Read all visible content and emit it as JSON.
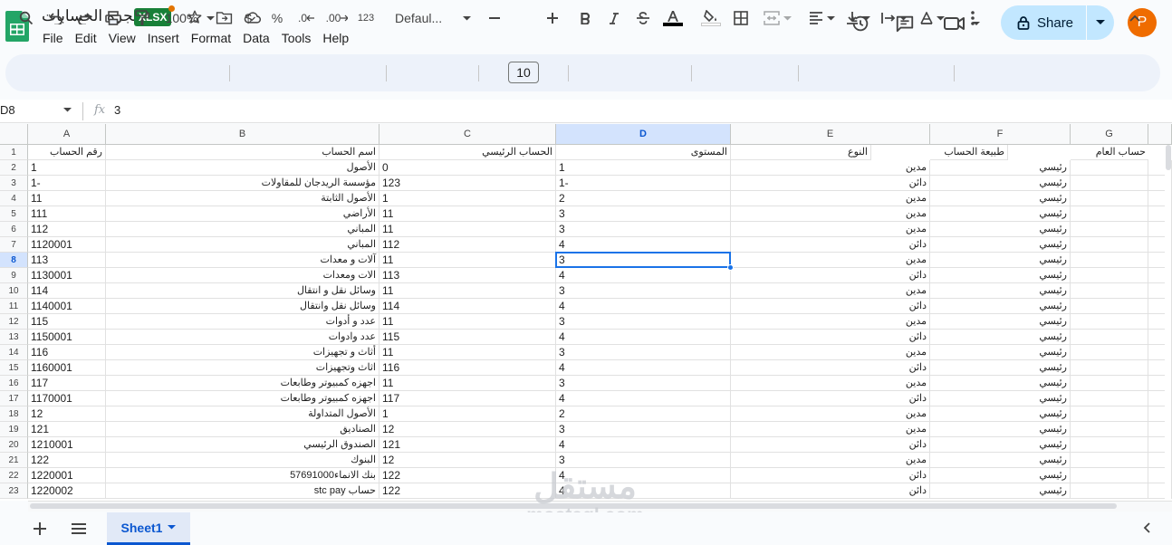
{
  "document": {
    "title": "شجره الحسابات",
    "file_badge": "XLSX"
  },
  "menu": [
    "File",
    "Edit",
    "View",
    "Insert",
    "Format",
    "Data",
    "Tools",
    "Help"
  ],
  "share": {
    "label": "Share"
  },
  "avatar": {
    "initial": "P",
    "color": "#ef6c00"
  },
  "toolbar": {
    "zoom": "100%",
    "currency": "$",
    "percent": "%",
    "dec_less": ".0",
    "dec_more": ".00",
    "number_format": "123",
    "font": "Defaul...",
    "font_size": "10"
  },
  "formula_bar": {
    "cell_ref": "D8",
    "fx": "fx",
    "value": "3"
  },
  "columns": [
    "A",
    "B",
    "C",
    "D",
    "E",
    "F",
    "G"
  ],
  "selected": {
    "row": 8,
    "col": "D",
    "accent": "#1a73e8"
  },
  "headers": {
    "A": "رقم الحساب",
    "B": "اسم الحساب",
    "C": "الحساب الرئيسي",
    "D": "المستوى",
    "E": "",
    "F": "النوع",
    "G": "طبيعة الحساب",
    "H": "حساب العام"
  },
  "rows": [
    {
      "n": "2",
      "a": "1",
      "b": "الأصول",
      "c": "0",
      "d": "1",
      "f": "مدين",
      "g": "رئيسي"
    },
    {
      "n": "3",
      "a": "1-",
      "b": "مؤسسة الريدجان للمقاولات",
      "c": "123",
      "d": "1-",
      "f": "دائن",
      "g": "رئيسي"
    },
    {
      "n": "4",
      "a": "11",
      "b": "الأصول الثابتة",
      "c": "1",
      "d": "2",
      "f": "مدين",
      "g": "رئيسي"
    },
    {
      "n": "5",
      "a": "111",
      "b": "الأراضي",
      "c": "11",
      "d": "3",
      "f": "مدين",
      "g": "رئيسي"
    },
    {
      "n": "6",
      "a": "112",
      "b": "المباني",
      "c": "11",
      "d": "3",
      "f": "مدين",
      "g": "رئيسي"
    },
    {
      "n": "7",
      "a": "1120001",
      "b": "المباني",
      "c": "112",
      "d": "4",
      "f": "دائن",
      "g": "رئيسي"
    },
    {
      "n": "8",
      "a": "113",
      "b": "آلات و معدات",
      "c": "11",
      "d": "3",
      "f": "مدين",
      "g": "رئيسي"
    },
    {
      "n": "9",
      "a": "1130001",
      "b": "الات ومعدات",
      "c": "113",
      "d": "4",
      "f": "دائن",
      "g": "رئيسي"
    },
    {
      "n": "10",
      "a": "114",
      "b": "وسائل نقل و انتقال",
      "c": "11",
      "d": "3",
      "f": "مدين",
      "g": "رئيسي"
    },
    {
      "n": "11",
      "a": "1140001",
      "b": "وسائل نقل وانتقال",
      "c": "114",
      "d": "4",
      "f": "دائن",
      "g": "رئيسي"
    },
    {
      "n": "12",
      "a": "115",
      "b": "عدد و أدوات",
      "c": "11",
      "d": "3",
      "f": "مدين",
      "g": "رئيسي"
    },
    {
      "n": "13",
      "a": "1150001",
      "b": "عدد وادوات",
      "c": "115",
      "d": "4",
      "f": "دائن",
      "g": "رئيسي"
    },
    {
      "n": "14",
      "a": "116",
      "b": "أثاث و تجهيزات",
      "c": "11",
      "d": "3",
      "f": "مدين",
      "g": "رئيسي"
    },
    {
      "n": "15",
      "a": "1160001",
      "b": "اثاث وتجهيزات",
      "c": "116",
      "d": "4",
      "f": "دائن",
      "g": "رئيسي"
    },
    {
      "n": "16",
      "a": "117",
      "b": "اجهزه كمبيوتر وطابعات",
      "c": "11",
      "d": "3",
      "f": "مدين",
      "g": "رئيسي"
    },
    {
      "n": "17",
      "a": "1170001",
      "b": "اجهزه كمبيوتر وطابعات",
      "c": "117",
      "d": "4",
      "f": "دائن",
      "g": "رئيسي"
    },
    {
      "n": "18",
      "a": "12",
      "b": "الأصول المتداولة",
      "c": "1",
      "d": "2",
      "f": "مدين",
      "g": "رئيسي"
    },
    {
      "n": "19",
      "a": "121",
      "b": "الصناديق",
      "c": "12",
      "d": "3",
      "f": "مدين",
      "g": "رئيسي"
    },
    {
      "n": "20",
      "a": "1210001",
      "b": "الصندوق الرئيسي",
      "c": "121",
      "d": "4",
      "f": "دائن",
      "g": "رئيسي"
    },
    {
      "n": "21",
      "a": "122",
      "b": "البنوك",
      "c": "12",
      "d": "3",
      "f": "مدين",
      "g": "رئيسي"
    },
    {
      "n": "22",
      "a": "1220001",
      "b": "بنك الانماء57691000",
      "c": "122",
      "d": "4",
      "f": "دائن",
      "g": "رئيسي"
    },
    {
      "n": "23",
      "a": "1220002",
      "b": "حساب stc pay",
      "c": "122",
      "d": "4",
      "f": "دائن",
      "g": "رئيسي"
    }
  ],
  "sheet": {
    "name": "Sheet1"
  },
  "watermark": {
    "arabic": "مستقل",
    "latin": "mostaql.com"
  }
}
